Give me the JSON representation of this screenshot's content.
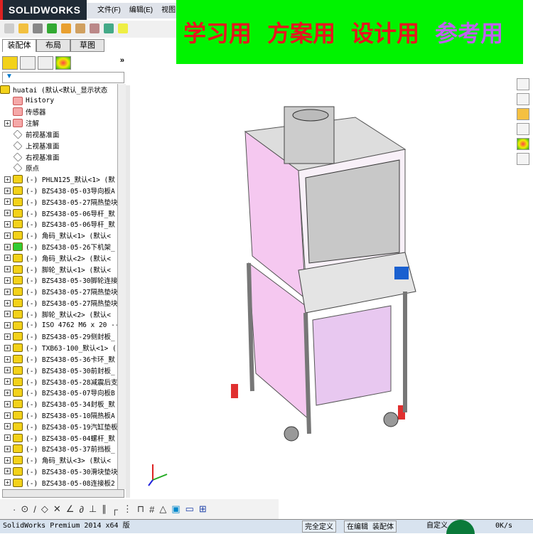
{
  "app": {
    "logo": "SOLIDWORKS",
    "menu": [
      "文件(F)",
      "编辑(E)",
      "视图"
    ]
  },
  "tabs": [
    "装配体",
    "布局",
    "草图"
  ],
  "panel": {
    "more": "»",
    "filter": "▼"
  },
  "tree": {
    "root": "huatai   (默认<默认_显示状态",
    "items": [
      {
        "label": "History",
        "type": "folder",
        "exp": false
      },
      {
        "label": "传感器",
        "type": "folder",
        "exp": false
      },
      {
        "label": "注解",
        "type": "folder",
        "exp": true
      },
      {
        "label": "前视基准面",
        "type": "plane",
        "exp": false
      },
      {
        "label": "上视基准面",
        "type": "plane",
        "exp": false
      },
      {
        "label": "右视基准面",
        "type": "plane",
        "exp": false
      },
      {
        "label": "原点",
        "type": "origin",
        "exp": false
      },
      {
        "label": "(-) PHLN125_默认<1> (默",
        "type": "part",
        "exp": true
      },
      {
        "label": "(-) BZS438-05-03导向板A",
        "type": "part",
        "exp": true
      },
      {
        "label": "(-) BZS438-05-27隔热垫块",
        "type": "part",
        "exp": true
      },
      {
        "label": "(-) BZS438-05-06导杆_默",
        "type": "part",
        "exp": true
      },
      {
        "label": "(-) BZS438-05-06导杆_默",
        "type": "part",
        "exp": true
      },
      {
        "label": "(-) 角码_默认<1> (默认<",
        "type": "part",
        "exp": true
      },
      {
        "label": "(-) BZS438-05-26下机架_",
        "type": "partg",
        "exp": true
      },
      {
        "label": "(-) 角码_默认<2> (默认<",
        "type": "part",
        "exp": true
      },
      {
        "label": "(-) 脚轮_默认<1> (默认<",
        "type": "part",
        "exp": true
      },
      {
        "label": "(-) BZS438-05-30脚轮连接",
        "type": "part",
        "exp": true
      },
      {
        "label": "(-) BZS438-05-27隔热垫块",
        "type": "part",
        "exp": true
      },
      {
        "label": "(-) BZS438-05-27隔热垫块",
        "type": "part",
        "exp": true
      },
      {
        "label": "(-) 脚轮_默认<2> (默认<",
        "type": "part",
        "exp": true
      },
      {
        "label": "(-) ISO 4762 M6 x 20 --",
        "type": "part",
        "exp": true
      },
      {
        "label": "(-) BZS438-05-29侧封板_",
        "type": "part",
        "exp": true
      },
      {
        "label": "(-) TXB63-100_默认<1> (",
        "type": "part",
        "exp": true
      },
      {
        "label": "(-) BZS438-05-36卡环_默",
        "type": "part",
        "exp": true
      },
      {
        "label": "(-) BZS438-05-30前封板_",
        "type": "part",
        "exp": true
      },
      {
        "label": "(-) BZS438-05-28减震后支",
        "type": "part",
        "exp": true
      },
      {
        "label": "(-) BZS438-05-07导向板B",
        "type": "part",
        "exp": true
      },
      {
        "label": "(-) BZS438-05-34封板_默",
        "type": "part",
        "exp": true
      },
      {
        "label": "(-) BZS438-05-10隔热板A",
        "type": "part",
        "exp": true
      },
      {
        "label": "(-) BZS438-05-19汽缸垫板",
        "type": "part",
        "exp": true
      },
      {
        "label": "(-) BZS438-05-04螺杆_默",
        "type": "part",
        "exp": true
      },
      {
        "label": "(-) BZS438-05-37前挡板_",
        "type": "part",
        "exp": true
      },
      {
        "label": "(-) 角码_默认<3> (默认<",
        "type": "part",
        "exp": true
      },
      {
        "label": "(-) BZS438-05-30滑块垫块",
        "type": "part",
        "exp": true
      },
      {
        "label": "(-) BZS438-05-08连接板2",
        "type": "part",
        "exp": true
      }
    ]
  },
  "banner": {
    "labels": [
      "学习用",
      "方案用",
      "设计用",
      "参考用"
    ],
    "colors": [
      "#e8141e",
      "#e8141e",
      "#e8141e",
      "#c060f0"
    ],
    "bg": "#00f300"
  },
  "status": {
    "product": "SolidWorks Premium 2014 x64 版",
    "state": "完全定义",
    "editing": "在编辑 装配体",
    "custom": "自定义",
    "speed": "0K/s"
  }
}
